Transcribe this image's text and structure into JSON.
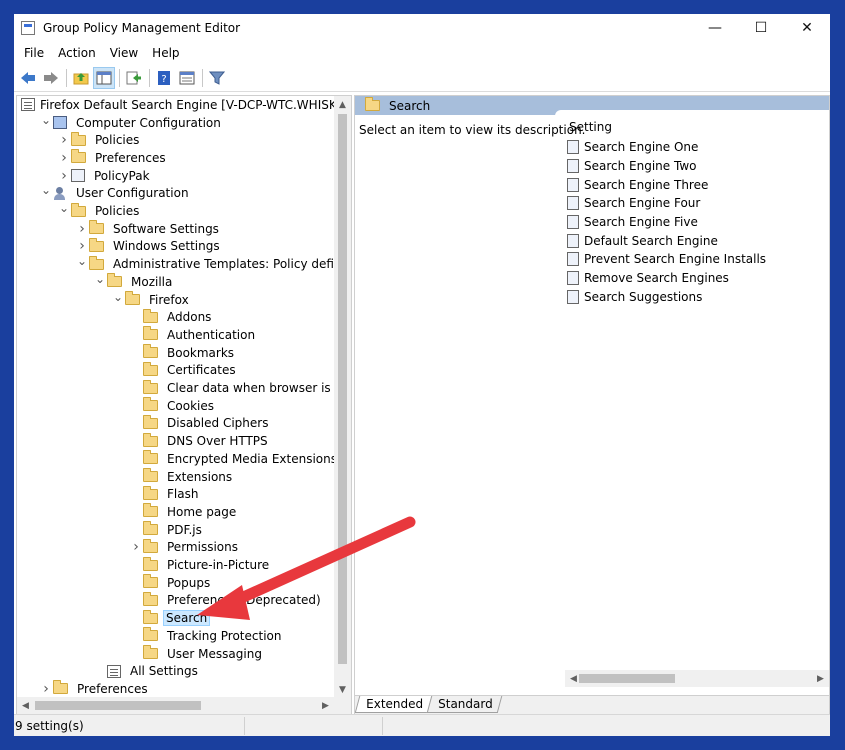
{
  "window": {
    "title": "Group Policy Management Editor",
    "controls": {
      "minimize": "—",
      "maximize": "☐",
      "close": "✕"
    }
  },
  "menu": [
    "File",
    "Action",
    "View",
    "Help"
  ],
  "toolbar": {
    "icons": [
      "back-arrow-icon",
      "forward-arrow-icon",
      "up-folder-icon",
      "show-hide-console-tree-icon",
      "export-list-icon",
      "help-icon",
      "properties-view-icon",
      "filter-icon"
    ]
  },
  "tree": {
    "root": "Firefox Default Search Engine [V-DCP-WTC.WHISKEYTIM",
    "items": [
      {
        "label": "Computer Configuration",
        "chevron": "v",
        "icon": "computer"
      },
      {
        "label": "Policies",
        "chevron": ">",
        "icon": "folder"
      },
      {
        "label": "Preferences",
        "chevron": ">",
        "icon": "folder"
      },
      {
        "label": "PolicyPak",
        "chevron": ">",
        "icon": "policypak"
      },
      {
        "label": "User Configuration",
        "chevron": "v",
        "icon": "user"
      },
      {
        "label": "Policies",
        "chevron": "v",
        "icon": "folder"
      },
      {
        "label": "Software Settings",
        "chevron": ">",
        "icon": "folder"
      },
      {
        "label": "Windows Settings",
        "chevron": ">",
        "icon": "folder"
      },
      {
        "label": "Administrative Templates: Policy definitions (A",
        "chevron": "v",
        "icon": "folder"
      },
      {
        "label": "Mozilla",
        "chevron": "v",
        "icon": "folder"
      },
      {
        "label": "Firefox",
        "chevron": "v",
        "icon": "folder"
      },
      {
        "label": "Addons",
        "chevron": "",
        "icon": "folder"
      },
      {
        "label": "Authentication",
        "chevron": "",
        "icon": "folder"
      },
      {
        "label": "Bookmarks",
        "chevron": "",
        "icon": "folder"
      },
      {
        "label": "Certificates",
        "chevron": "",
        "icon": "folder"
      },
      {
        "label": "Clear data when browser is closed",
        "chevron": "",
        "icon": "folder"
      },
      {
        "label": "Cookies",
        "chevron": "",
        "icon": "folder"
      },
      {
        "label": "Disabled Ciphers",
        "chevron": "",
        "icon": "folder"
      },
      {
        "label": "DNS Over HTTPS",
        "chevron": "",
        "icon": "folder"
      },
      {
        "label": "Encrypted Media Extensions",
        "chevron": "",
        "icon": "folder"
      },
      {
        "label": "Extensions",
        "chevron": "",
        "icon": "folder"
      },
      {
        "label": "Flash",
        "chevron": "",
        "icon": "folder"
      },
      {
        "label": "Home page",
        "chevron": "",
        "icon": "folder"
      },
      {
        "label": "PDF.js",
        "chevron": "",
        "icon": "folder"
      },
      {
        "label": "Permissions",
        "chevron": ">",
        "icon": "folder"
      },
      {
        "label": "Picture-in-Picture",
        "chevron": "",
        "icon": "folder"
      },
      {
        "label": "Popups",
        "chevron": "",
        "icon": "folder"
      },
      {
        "label": "Preferences (Deprecated)",
        "chevron": "",
        "icon": "folder"
      },
      {
        "label": "Search",
        "chevron": "",
        "icon": "folder",
        "selected": true
      },
      {
        "label": "Tracking Protection",
        "chevron": "",
        "icon": "folder"
      },
      {
        "label": "User Messaging",
        "chevron": "",
        "icon": "folder"
      },
      {
        "label": "All Settings",
        "chevron": "",
        "icon": "allsettings"
      },
      {
        "label": "Preferences",
        "chevron": ">",
        "icon": "folder"
      }
    ]
  },
  "right_pane": {
    "header": "Search",
    "description": "Select an item to view its description.",
    "column_header": "Setting",
    "settings": [
      "Search Engine One",
      "Search Engine Two",
      "Search Engine Three",
      "Search Engine Four",
      "Search Engine Five",
      "Default Search Engine",
      "Prevent Search Engine Installs",
      "Remove Search Engines",
      "Search Suggestions"
    ],
    "tabs": [
      "Extended",
      "Standard"
    ],
    "active_tab": "Extended"
  },
  "status": {
    "text": "9 setting(s)"
  },
  "annotation": {
    "color": "#e8383d"
  }
}
